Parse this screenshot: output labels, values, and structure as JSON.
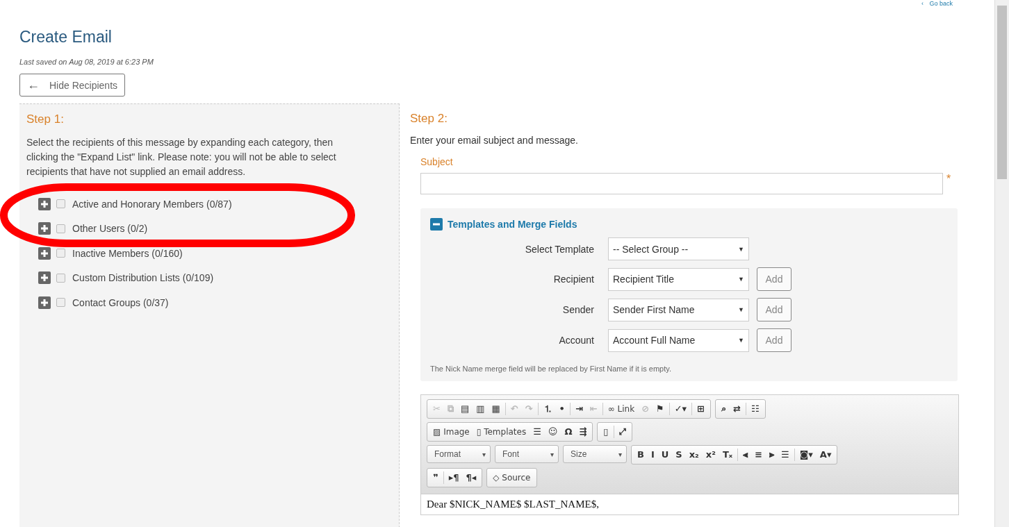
{
  "go_back": {
    "icon": "‹",
    "label": "Go back"
  },
  "title": "Create Email",
  "last_saved": "Last saved on Aug 08, 2019 at 6:23 PM",
  "hide_recipients": {
    "icon": "←",
    "label": "Hide Recipients"
  },
  "step1": {
    "heading": "Step 1:",
    "intro": "Select the recipients of this message by expanding each category, then clicking the \"Expand List\" link. Please note: you will not be able to select recipients that have not supplied an email address.",
    "categories": [
      {
        "label": "Active and Honorary Members (0/87)",
        "checked": false,
        "expanded": false
      },
      {
        "label": "Other Users (0/2)",
        "checked": false,
        "expanded": false
      },
      {
        "label": "Inactive Members (0/160)",
        "checked": false,
        "expanded": false
      },
      {
        "label": "Custom Distribution Lists (0/109)",
        "checked": false,
        "expanded": false
      },
      {
        "label": "Contact Groups (0/37)",
        "checked": false,
        "expanded": false
      }
    ]
  },
  "step2": {
    "heading": "Step 2:",
    "intro": "Enter your email subject and message.",
    "subject": {
      "label": "Subject",
      "required_mark": "*"
    },
    "merge_panel": {
      "title": "Templates and Merge Fields",
      "expanded": true,
      "rows": [
        {
          "label": "Select Template",
          "value": "-- Select Group --",
          "caret": "▼"
        },
        {
          "label": "Recipient",
          "value": "Recipient Title",
          "caret": "▼",
          "button": "Add"
        },
        {
          "label": "Sender",
          "value": "Sender First Name",
          "caret": "▼",
          "button": "Add"
        },
        {
          "label": "Account",
          "value": "Account Full Name",
          "caret": "▼",
          "button": "Add"
        }
      ],
      "note": "The Nick Name merge field will be replaced by First Name if it is empty."
    },
    "editor": {
      "toolbar": [
        [
          [
            {
              "kind": "icon",
              "glyph": "✂",
              "disabled": true
            },
            {
              "kind": "icon",
              "glyph": "⧉",
              "disabled": true
            },
            {
              "kind": "icon",
              "glyph": "▤",
              "disabled": false
            },
            {
              "kind": "icon",
              "glyph": "▥",
              "disabled": false
            },
            {
              "kind": "icon",
              "glyph": "▦",
              "disabled": false
            },
            {
              "kind": "sep"
            },
            {
              "kind": "icon",
              "glyph": "↶",
              "disabled": true
            },
            {
              "kind": "icon",
              "glyph": "↷",
              "disabled": true
            },
            {
              "kind": "sep"
            },
            {
              "kind": "icon",
              "glyph": "⒈",
              "disabled": false
            },
            {
              "kind": "icon",
              "glyph": "•",
              "disabled": false
            },
            {
              "kind": "sep"
            },
            {
              "kind": "icon",
              "glyph": "⇥",
              "disabled": false
            },
            {
              "kind": "icon",
              "glyph": "⇤",
              "disabled": true
            },
            {
              "kind": "sep"
            },
            {
              "kind": "labeled",
              "glyph": "∞",
              "label": "Link",
              "disabled": false
            },
            {
              "kind": "icon",
              "glyph": "⊘",
              "disabled": true
            },
            {
              "kind": "icon",
              "glyph": "⚑",
              "disabled": false
            },
            {
              "kind": "sep"
            },
            {
              "kind": "icon",
              "glyph": "✓▾",
              "disabled": false
            },
            {
              "kind": "sep"
            },
            {
              "kind": "icon",
              "glyph": "⊞",
              "disabled": false
            }
          ],
          [
            {
              "kind": "icon",
              "glyph": "⌕",
              "disabled": false
            },
            {
              "kind": "icon",
              "glyph": "⇄",
              "disabled": false
            },
            {
              "kind": "sep"
            },
            {
              "kind": "icon",
              "glyph": "☷",
              "disabled": false
            }
          ]
        ],
        [
          [
            {
              "kind": "labeled",
              "glyph": "▨",
              "label": "Image",
              "disabled": false
            },
            {
              "kind": "labeled",
              "glyph": "▯",
              "label": "Templates",
              "disabled": false
            },
            {
              "kind": "icon",
              "glyph": "☰",
              "disabled": false
            },
            {
              "kind": "icon",
              "glyph": "☺",
              "disabled": false
            },
            {
              "kind": "icon",
              "glyph": "Ω",
              "disabled": false
            },
            {
              "kind": "icon",
              "glyph": "⇶",
              "disabled": false
            }
          ],
          [
            {
              "kind": "icon",
              "glyph": "▯",
              "disabled": false
            },
            {
              "kind": "sep"
            },
            {
              "kind": "icon",
              "glyph": "⤢",
              "disabled": false
            }
          ]
        ],
        [
          [
            {
              "kind": "combo",
              "label": "Format",
              "caret": "▾"
            }
          ],
          [
            {
              "kind": "combo",
              "label": "Font",
              "caret": "▾"
            }
          ],
          [
            {
              "kind": "combo",
              "label": "Size",
              "caret": "▾"
            }
          ],
          [
            {
              "kind": "icon",
              "glyph": "B",
              "disabled": false
            },
            {
              "kind": "icon",
              "glyph": "I",
              "disabled": false
            },
            {
              "kind": "icon",
              "glyph": "U",
              "disabled": false
            },
            {
              "kind": "icon",
              "glyph": "S",
              "disabled": false
            },
            {
              "kind": "icon",
              "glyph": "x₂",
              "disabled": false
            },
            {
              "kind": "icon",
              "glyph": "x²",
              "disabled": false
            },
            {
              "kind": "icon",
              "glyph": "Tₓ",
              "disabled": false
            },
            {
              "kind": "sep"
            },
            {
              "kind": "icon",
              "glyph": "⫷",
              "disabled": false
            },
            {
              "kind": "icon",
              "glyph": "≡",
              "disabled": false
            },
            {
              "kind": "icon",
              "glyph": "⫸",
              "disabled": false
            },
            {
              "kind": "icon",
              "glyph": "☰",
              "disabled": false
            },
            {
              "kind": "sep"
            },
            {
              "kind": "icon",
              "glyph": "◙▾",
              "disabled": false
            },
            {
              "kind": "icon",
              "glyph": "A▾",
              "disabled": false
            }
          ]
        ],
        [
          [
            {
              "kind": "icon",
              "glyph": "❞",
              "disabled": false
            },
            {
              "kind": "sep"
            },
            {
              "kind": "icon",
              "glyph": "▸¶",
              "disabled": false
            },
            {
              "kind": "icon",
              "glyph": "¶◂",
              "disabled": false
            }
          ],
          [
            {
              "kind": "labeled",
              "glyph": "◇",
              "label": "Source",
              "disabled": false
            }
          ]
        ]
      ],
      "body": "Dear $NICK_NAME$ $LAST_NAME$,"
    }
  }
}
